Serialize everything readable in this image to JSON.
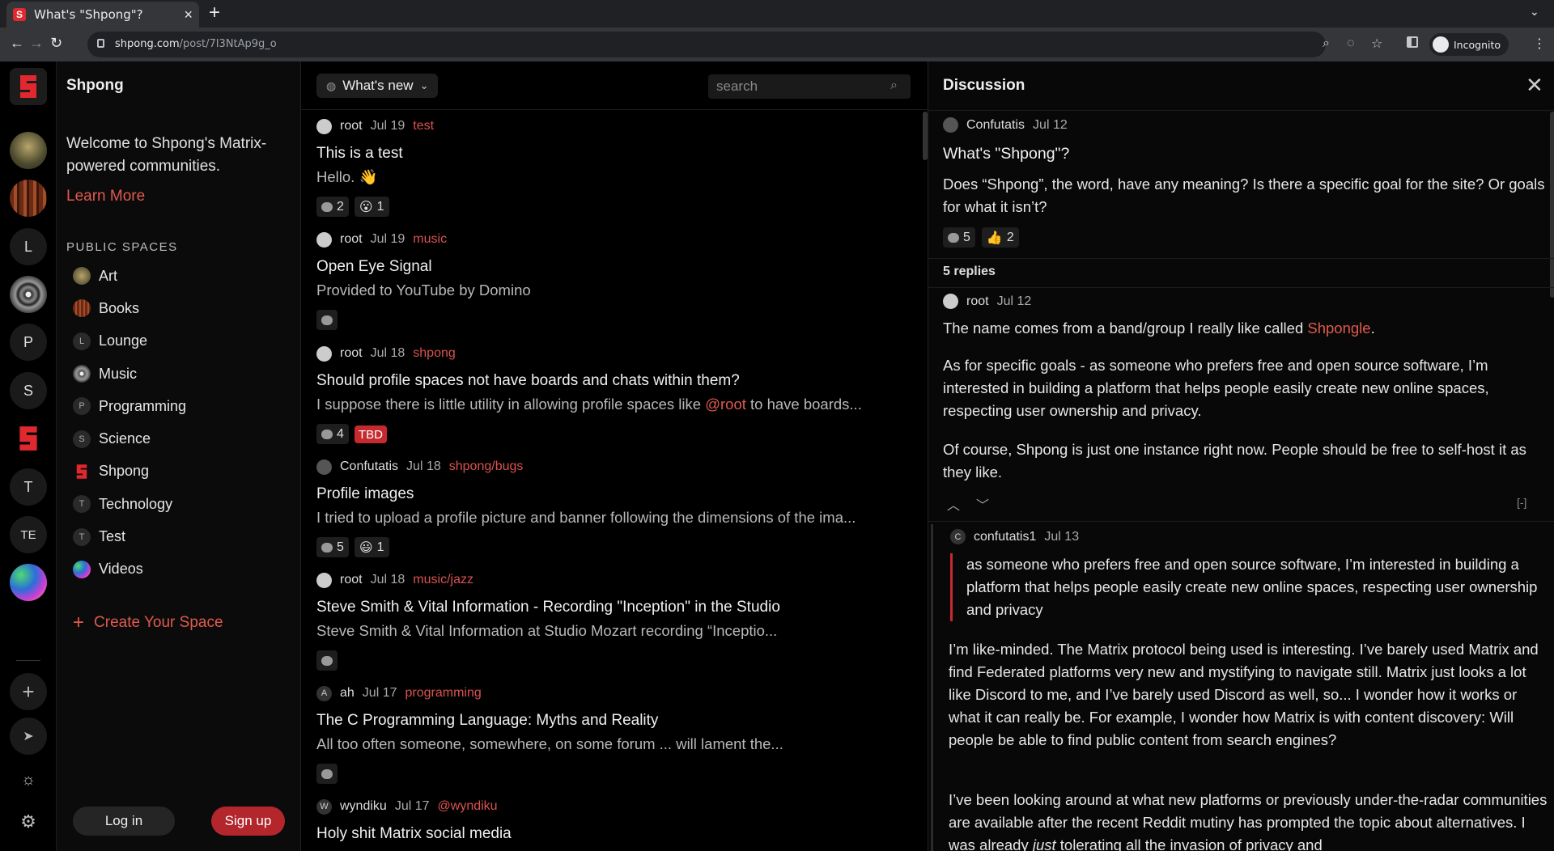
{
  "browser": {
    "tab_title": "What's \"Shpong\"?",
    "tab_close": "×",
    "new_tab": "+",
    "url_host": "shpong.com",
    "url_path": "/post/7I3NtAp9g_o",
    "profile_label": "Incognito"
  },
  "rail": {
    "letters": [
      "L",
      "P",
      "S",
      "T",
      "TE"
    ]
  },
  "sidebar": {
    "brand": "Shpong",
    "welcome": "Welcome to Shpong's Matrix-powered communities.",
    "learn_more": "Learn More",
    "section_title": "PUBLIC SPACES",
    "spaces": [
      {
        "label": "Art",
        "icon": "art-avatar-icon"
      },
      {
        "label": "Books",
        "icon": "books-avatar-icon"
      },
      {
        "label": "Lounge",
        "letter": "L"
      },
      {
        "label": "Music",
        "icon": "music-avatar-icon"
      },
      {
        "label": "Programming",
        "letter": "P"
      },
      {
        "label": "Science",
        "letter": "S"
      },
      {
        "label": "Shpong",
        "icon": "shpong-logo-icon"
      },
      {
        "label": "Technology",
        "letter": "T"
      },
      {
        "label": "Test",
        "letter": "T"
      },
      {
        "label": "Videos",
        "icon": "videos-avatar-icon"
      }
    ],
    "create_space": "Create Your Space",
    "login": "Log in",
    "signup": "Sign up"
  },
  "feed": {
    "filter_label": "What's new",
    "search_placeholder": "search",
    "posts": [
      {
        "author": "root",
        "date": "Jul 19",
        "channel": "test",
        "title": "This is a test",
        "body": "Hello. 👋",
        "comments": "2",
        "reaction_emoji": "😮",
        "reaction_count": "1"
      },
      {
        "author": "root",
        "date": "Jul 19",
        "channel": "music",
        "title": "Open Eye Signal",
        "body": "Provided to YouTube by Domino"
      },
      {
        "author": "root",
        "date": "Jul 18",
        "channel": "shpong",
        "title": "Should profile spaces not have boards and chats within them?",
        "body_pre": "I suppose there is little utility in allowing profile spaces like ",
        "body_mention": "@root",
        "body_post": " to have boards...",
        "comments": "4",
        "tag": "TBD"
      },
      {
        "author": "Confutatis",
        "date": "Jul 18",
        "channel": "shpong/bugs",
        "title": "Profile images",
        "body": "I tried to upload a profile picture and banner following the dimensions of the ima...",
        "comments": "5",
        "reaction_emoji": "😃",
        "reaction_count": "1"
      },
      {
        "author": "root",
        "date": "Jul 18",
        "channel": "music/jazz",
        "title": "Steve Smith & Vital Information - Recording \"Inception\" in the Studio",
        "body": "Steve Smith & Vital Information at Studio Mozart recording “Inceptio..."
      },
      {
        "author": "ah",
        "date": "Jul 17",
        "channel": "programming",
        "title": "The C Programming Language: Myths and Reality",
        "body": "All too often someone, somewhere, on some forum ... will lament the..."
      },
      {
        "author": "wyndiku",
        "date": "Jul 17",
        "channel": "@wyndiku",
        "title": "Holy shit Matrix social media"
      }
    ],
    "author_letters": {
      "ah": "A",
      "wyndiku": "W"
    }
  },
  "discussion": {
    "header": "Discussion",
    "close": "✕",
    "op": {
      "author": "Confutatis",
      "date": "Jul 12",
      "title": "What's \"Shpong\"?",
      "body": "Does “Shpong”, the word, have any meaning? Is there a specific goal for the site? Or goals for what it isn’t?",
      "comments": "5",
      "reaction_emoji": "👍",
      "reaction_count": "2"
    },
    "replies_count": "5 replies",
    "reply1": {
      "author": "root",
      "date": "Jul 12",
      "p1_pre": "The name comes from a band/group I really like called ",
      "p1_link": "Shpongle",
      "p1_post": ".",
      "p2": "As for specific goals - as someone who prefers free and open source software, I’m interested in building a platform that helps people easily create new online spaces, respecting user ownership and privacy.",
      "p3": "Of course, Shpong is just one instance right now. People should be free to self-host it as they like.",
      "collapse": "[-]"
    },
    "reply2": {
      "author": "confutatis1",
      "author_letter": "C",
      "date": "Jul 13",
      "quote": "as someone who prefers free and open source software, I’m interested in building a platform that helps people easily create new online spaces, respecting user ownership and privacy",
      "p1": "I’m like-minded. The Matrix protocol being used is interesting. I’ve barely used Matrix and find Federated platforms very new and mystifying to navigate still. Matrix just looks a lot like Discord to me, and I’ve barely used Discord as well, so... I wonder how it works or what it can really be. For example, I wonder how Matrix is with content discovery: Will people be able to find public content from search engines?",
      "p2_pre": "I’ve been looking around at what new platforms or previously under-the-radar communities are available after the recent Reddit mutiny has prompted the topic about alternatives. I was already ",
      "p2_em": "just",
      "p2_post": " tolerating all the invasion of privacy and"
    }
  },
  "colors": {
    "accent": "#e05a4e",
    "brand_red": "#e0282e",
    "tag_red": "#c62a2f"
  }
}
